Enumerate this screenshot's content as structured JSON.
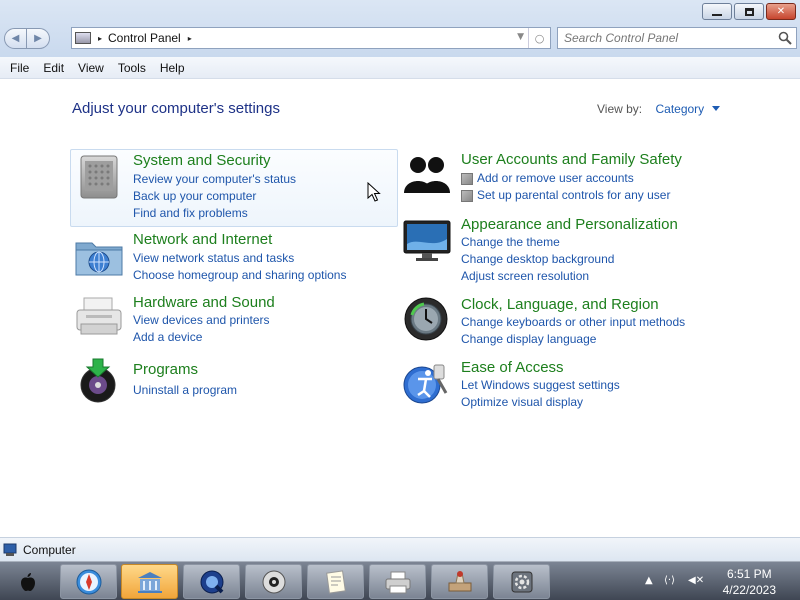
{
  "window": {
    "minimize_glyph": "minimize-icon",
    "maximize_glyph": "restore-icon",
    "close_label": "✕"
  },
  "address": {
    "location": "Control Panel",
    "separator": "▸",
    "search_placeholder": "Search Control Panel"
  },
  "menu": [
    "File",
    "Edit",
    "View",
    "Tools",
    "Help"
  ],
  "main": {
    "title": "Adjust your computer's settings",
    "viewby_label": "View by:",
    "viewby_value": "Category",
    "categories": [
      {
        "title": "System and Security",
        "icon": "mac-pro-icon",
        "links": [
          "Review your computer's status",
          "Back up your computer",
          "Find and fix problems"
        ]
      },
      {
        "title": "Network and Internet",
        "icon": "network-folder-icon",
        "links": [
          "View network status and tasks",
          "Choose homegroup and sharing options"
        ]
      },
      {
        "title": "Hardware and Sound",
        "icon": "printer-icon",
        "links": [
          "View devices and printers",
          "Add a device"
        ]
      },
      {
        "title": "Programs",
        "icon": "install-disc-icon",
        "links": [
          "Uninstall a program"
        ]
      },
      {
        "title": "User Accounts and Family Safety",
        "icon": "users-icon",
        "links": [
          "Add or remove user accounts",
          "Set up parental controls for any user"
        ]
      },
      {
        "title": "Appearance and Personalization",
        "icon": "monitor-icon",
        "links": [
          "Change the theme",
          "Change desktop background",
          "Adjust screen resolution"
        ]
      },
      {
        "title": "Clock, Language, and Region",
        "icon": "time-machine-icon",
        "links": [
          "Change keyboards or other input methods",
          "Change display language"
        ]
      },
      {
        "title": "Ease of Access",
        "icon": "accessibility-icon",
        "links": [
          "Let Windows suggest settings",
          "Optimize visual display"
        ]
      }
    ]
  },
  "status": {
    "text": "Computer"
  },
  "taskbar": {
    "time": "6:51 PM",
    "date": "4/22/2023"
  },
  "colors": {
    "title_blue": "#1e3287",
    "category_green": "#1d7f1d",
    "link_blue": "#1f56ab"
  }
}
